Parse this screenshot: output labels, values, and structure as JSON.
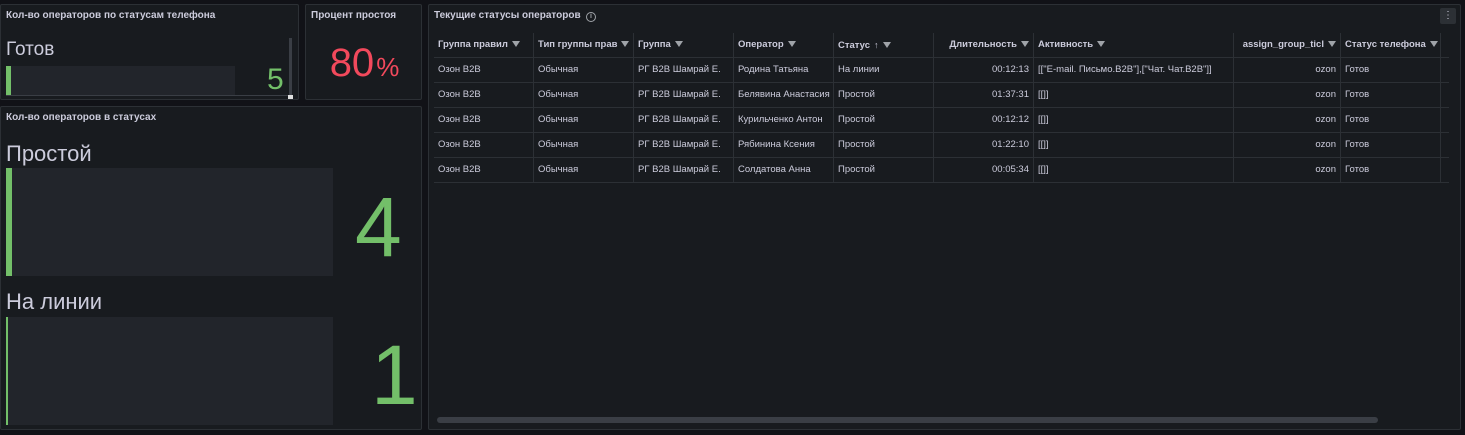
{
  "panel_phone": {
    "title": "Кол-во операторов по статусам телефона",
    "label": "Готов",
    "value": "5",
    "fill_fraction": 0.02
  },
  "panel_idle": {
    "title": "Процент простоя",
    "value": "80",
    "unit": "%"
  },
  "panel_statuses": {
    "title": "Кол-во операторов в статусах",
    "items": [
      {
        "label": "Простой",
        "value": "4",
        "fill_fraction": 0.018
      },
      {
        "label": "На линии",
        "value": "1",
        "fill_fraction": 0.006
      }
    ]
  },
  "panel_table": {
    "title": "Текущие статусы операторов",
    "info_icon": "info-icon",
    "menu_icon": "⋮",
    "columns": [
      "Группа правил",
      "Тип группы прав",
      "Группа",
      "Оператор",
      "Статус",
      "Длительность",
      "Активность",
      "assign_group_ticl",
      "Статус телефона"
    ],
    "sort_indicator": "↑",
    "rows": [
      [
        "Озон B2B",
        "Обычная",
        "РГ B2B Шамрай Е.",
        "Родина Татьяна",
        "На линии",
        "00:12:13",
        "[[\"E-mail. Письмо.B2B\"],[\"Чат. Чат.B2B\"]]",
        "ozon",
        "Готов"
      ],
      [
        "Озон B2B",
        "Обычная",
        "РГ B2B Шамрай Е.",
        "Белявина Анастасия",
        "Простой",
        "01:37:31",
        "[[]]",
        "ozon",
        "Готов"
      ],
      [
        "Озон B2B",
        "Обычная",
        "РГ B2B Шамрай Е.",
        "Курильченко Антон",
        "Простой",
        "00:12:12",
        "[[]]",
        "ozon",
        "Готов"
      ],
      [
        "Озон B2B",
        "Обычная",
        "РГ B2B Шамрай Е.",
        "Рябинина Ксения",
        "Простой",
        "01:22:10",
        "[[]]",
        "ozon",
        "Готов"
      ],
      [
        "Озон B2B",
        "Обычная",
        "РГ B2B Шамрай Е.",
        "Солдатова Анна",
        "Простой",
        "00:05:34",
        "[[]]",
        "ozon",
        "Готов"
      ]
    ]
  },
  "colors": {
    "background": "#111217",
    "panel": "#181b1f",
    "green": "#73bf69",
    "red": "#f2495c"
  }
}
